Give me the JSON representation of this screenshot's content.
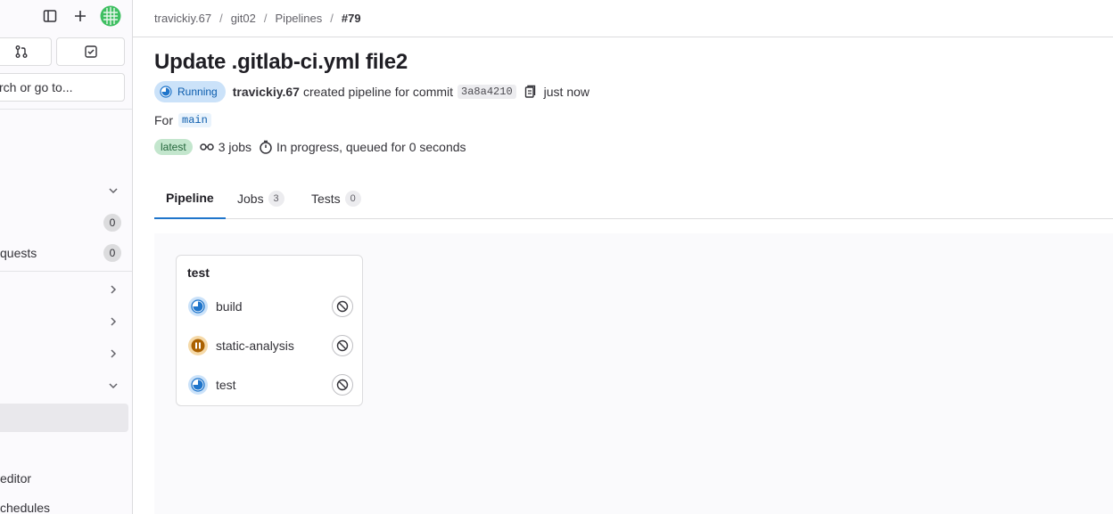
{
  "sidebar": {
    "search_placeholder": "rch or go to...",
    "items": [
      {
        "label": "",
        "count": "0"
      },
      {
        "label": "quests",
        "count": "0"
      },
      {
        "label": "editor"
      },
      {
        "label": "chedules"
      }
    ]
  },
  "breadcrumb": {
    "user": "travickiy.67",
    "project": "git02",
    "section": "Pipelines",
    "current": "#79",
    "separator": "/"
  },
  "pipeline": {
    "title": "Update .gitlab-ci.yml file2",
    "status": "Running",
    "author": "travickiy.67",
    "action_text": "created pipeline for commit",
    "sha": "3a8a4210",
    "time": "just now",
    "for_label": "For",
    "branch": "main",
    "latest_badge": "latest",
    "jobs_text": "3 jobs",
    "progress_text": "In progress, queued for 0 seconds"
  },
  "tabs": [
    {
      "label": "Pipeline"
    },
    {
      "label": "Jobs",
      "count": "3"
    },
    {
      "label": "Tests",
      "count": "0"
    }
  ],
  "stage": {
    "name": "test",
    "jobs": [
      {
        "name": "build",
        "status": "running"
      },
      {
        "name": "static-analysis",
        "status": "manual"
      },
      {
        "name": "test",
        "status": "running"
      }
    ]
  },
  "colors": {
    "accent": "#1f75cb",
    "running": "#1f75cb",
    "manual": "#ab6100",
    "success_badge": "#c3e6cd"
  }
}
